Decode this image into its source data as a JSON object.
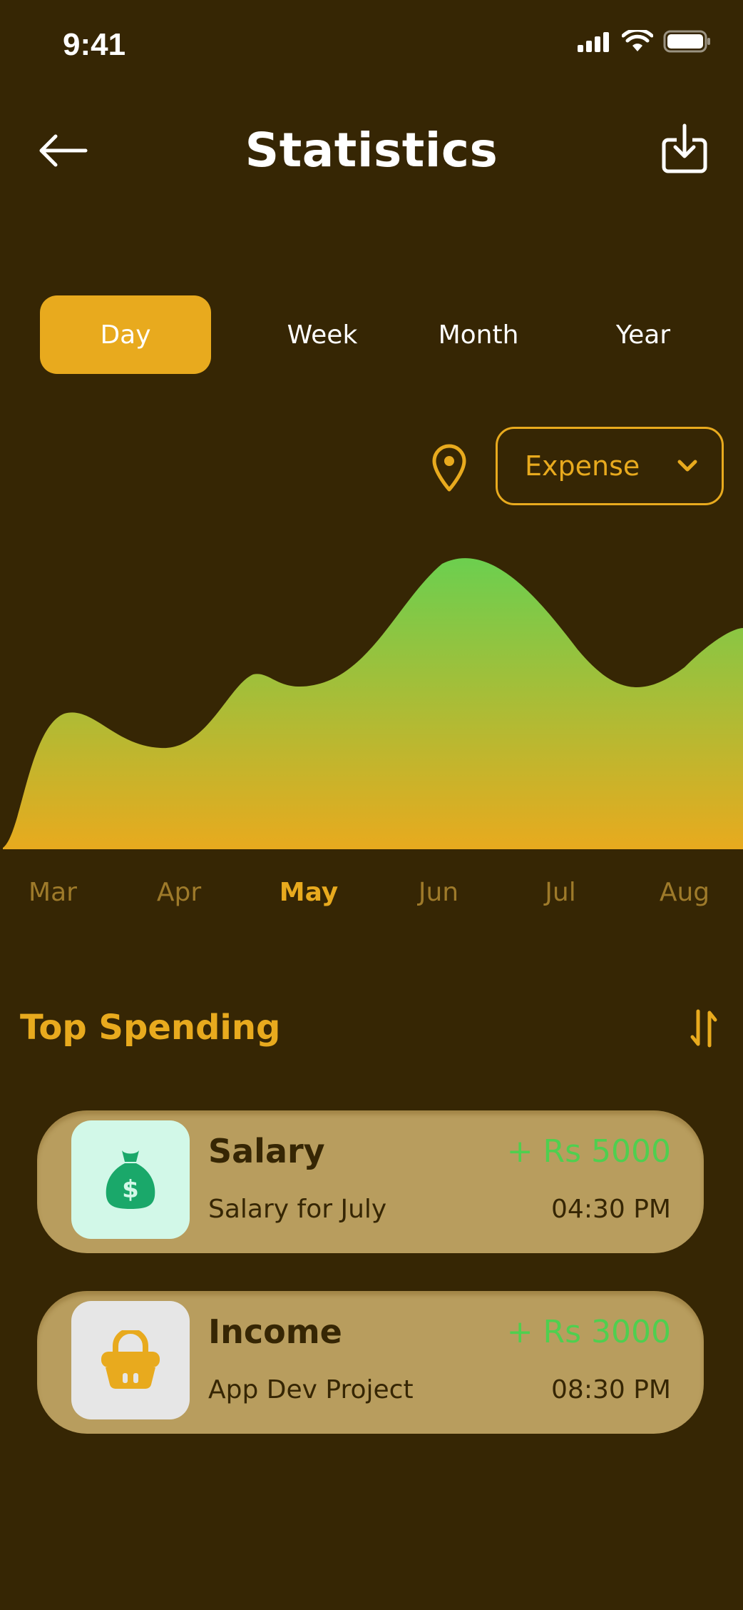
{
  "status_bar": {
    "time": "9:41"
  },
  "header": {
    "title": "Statistics"
  },
  "tabs": [
    {
      "label": "Day",
      "active": true
    },
    {
      "label": "Week",
      "active": false
    },
    {
      "label": "Month",
      "active": false
    },
    {
      "label": "Year",
      "active": false
    }
  ],
  "filter": {
    "selected": "Expense"
  },
  "chart_data": {
    "type": "area",
    "categories": [
      "Mar",
      "Apr",
      "May",
      "Jun",
      "Jul",
      "Aug"
    ],
    "highlighted_category": "May",
    "gradient_colors": [
      "#6ccf4f",
      "#e8aa1e"
    ]
  },
  "top_spending": {
    "title": "Top Spending",
    "items": [
      {
        "title": "Salary",
        "subtitle": "Salary for July",
        "amount": "+ Rs 5000",
        "time": "04:30 PM",
        "icon": "money-bag-icon",
        "icon_bg": "#d2f8e8",
        "icon_color": "#1aa86a"
      },
      {
        "title": "Income",
        "subtitle": "App Dev Project",
        "amount": "+ Rs 3000",
        "time": "08:30 PM",
        "icon": "basket-icon",
        "icon_bg": "#e6e6e6",
        "icon_color": "#e8aa1e"
      }
    ]
  },
  "colors": {
    "background": "#362604",
    "accent": "#e8aa1e",
    "card": "#b89d5e",
    "positive": "#4fcf4f"
  }
}
